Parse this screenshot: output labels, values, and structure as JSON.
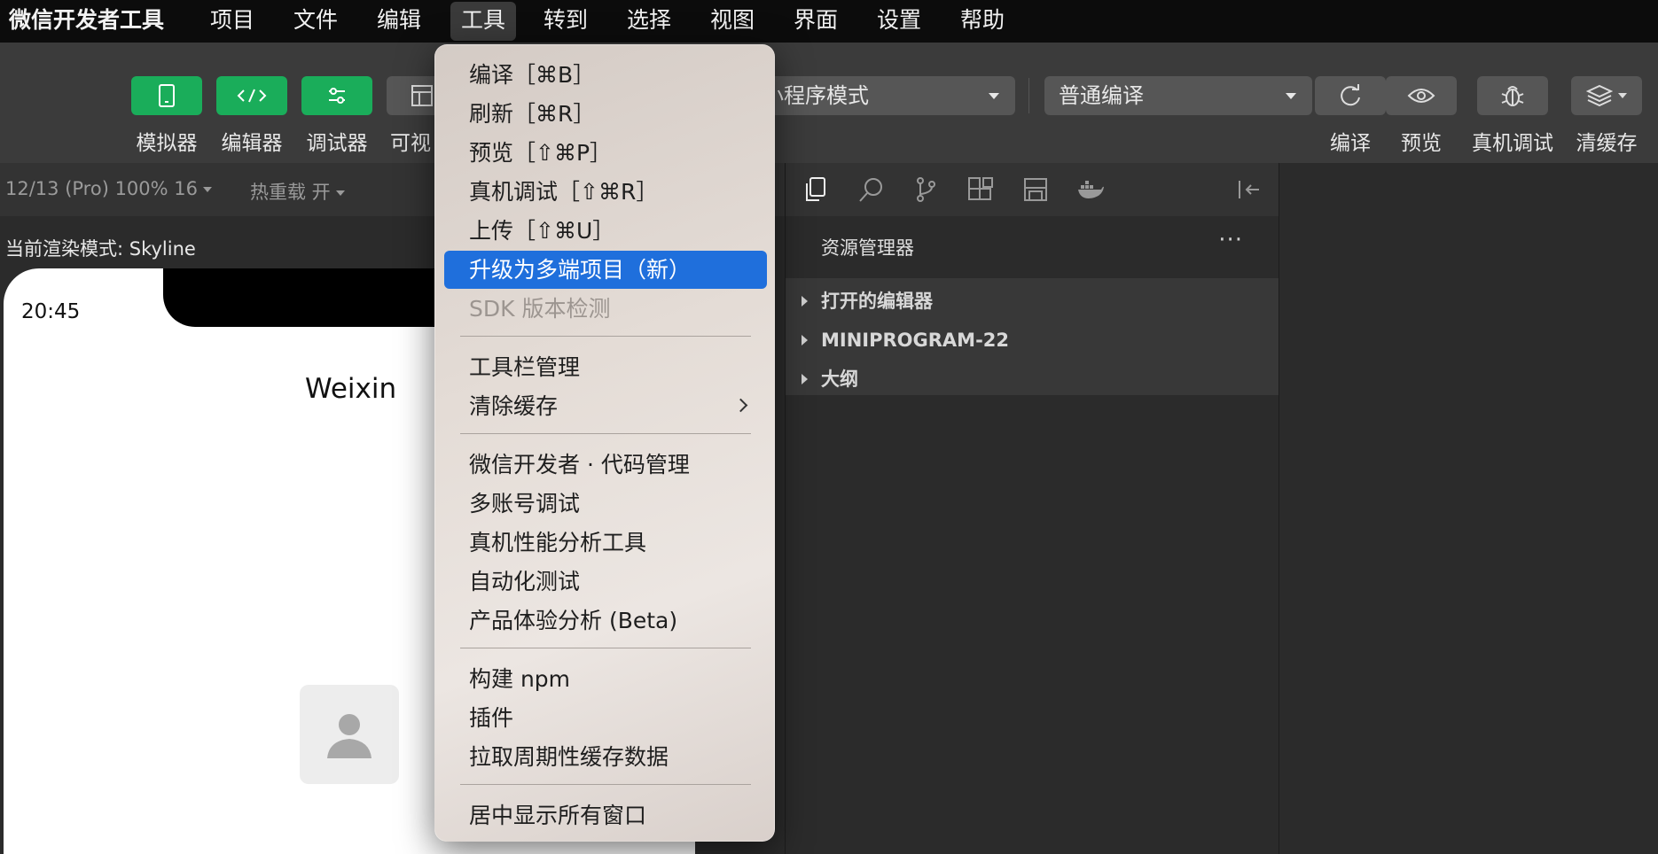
{
  "menubar": {
    "app_name": "微信开发者工具",
    "items": [
      "项目",
      "文件",
      "编辑",
      "工具",
      "转到",
      "选择",
      "视图",
      "界面",
      "设置",
      "帮助"
    ],
    "active_index": 3
  },
  "toolbar": {
    "simulator_label": "模拟器",
    "editor_label": "编辑器",
    "debugger_label": "调试器",
    "visual_label": "可视",
    "mode_select_value": "小程序模式",
    "compile_select_value": "普通编译",
    "compile_label": "编译",
    "preview_label": "预览",
    "remote_debug_label": "真机调试",
    "clear_cache_label": "清缓存"
  },
  "simulator": {
    "device_text": "12/13 (Pro) 100% 16",
    "hot_reload_text": "热重载 开",
    "render_mode_text": "当前渲染模式: Skyline",
    "clock": "20:45",
    "page_title": "Weixin"
  },
  "explorer": {
    "title": "资源管理器",
    "more": "···",
    "sections": [
      "打开的编辑器",
      "MINIPROGRAM-22",
      "大纲"
    ]
  },
  "tools_menu": {
    "items": [
      {
        "label": "编译［⌘B］",
        "state": "normal"
      },
      {
        "label": "刷新［⌘R］",
        "state": "normal"
      },
      {
        "label": "预览［⇧⌘P］",
        "state": "normal"
      },
      {
        "label": "真机调试［⇧⌘R］",
        "state": "normal"
      },
      {
        "label": "上传［⇧⌘U］",
        "state": "normal"
      },
      {
        "label": "升级为多端项目（新）",
        "state": "highlighted"
      },
      {
        "label": "SDK 版本检测",
        "state": "disabled"
      },
      {
        "label": "工具栏管理",
        "state": "normal"
      },
      {
        "label": "清除缓存",
        "state": "submenu"
      },
      {
        "label": "微信开发者 · 代码管理",
        "state": "normal"
      },
      {
        "label": "多账号调试",
        "state": "normal"
      },
      {
        "label": "真机性能分析工具",
        "state": "normal"
      },
      {
        "label": "自动化测试",
        "state": "normal"
      },
      {
        "label": "产品体验分析 (Beta)",
        "state": "normal"
      },
      {
        "label": "构建 npm",
        "state": "normal"
      },
      {
        "label": "插件",
        "state": "normal"
      },
      {
        "label": "拉取周期性缓存数据",
        "state": "normal"
      },
      {
        "label": "居中显示所有窗口",
        "state": "normal"
      }
    ]
  },
  "colors": {
    "accent_green": "#1aad5a",
    "highlight_blue": "#1f6fdc"
  }
}
